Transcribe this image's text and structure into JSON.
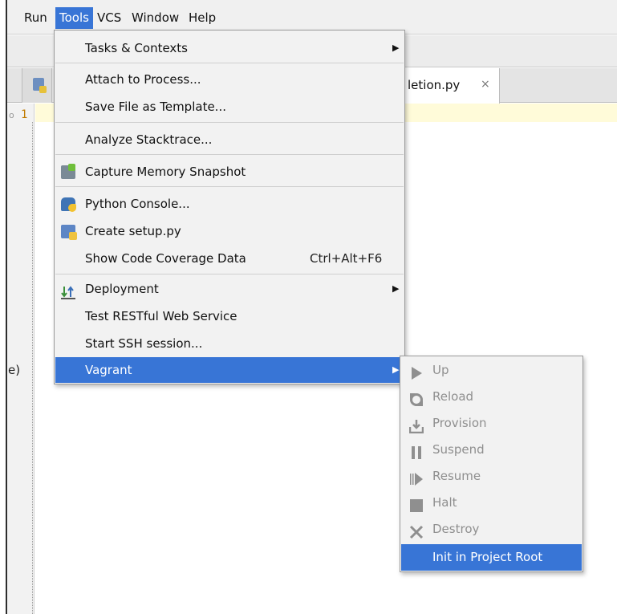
{
  "menubar": {
    "items": [
      {
        "label": "Run"
      },
      {
        "label": "Tools"
      },
      {
        "label": "VCS"
      },
      {
        "label": "Window"
      },
      {
        "label": "Help"
      }
    ]
  },
  "editor": {
    "active_tab": {
      "label": "letion.py",
      "close": "×"
    },
    "line_number": "1",
    "gutter_marker": "o",
    "side_text": "e)"
  },
  "tools_menu": {
    "items": [
      {
        "label": "Tasks & Contexts",
        "has_submenu": true
      },
      {
        "label": "Attach to Process..."
      },
      {
        "label": "Save File as Template..."
      },
      {
        "label": "Analyze Stacktrace..."
      },
      {
        "label": "Capture Memory Snapshot",
        "icon": "memory-snapshot-icon"
      },
      {
        "label": "Python Console...",
        "icon": "python-console-icon"
      },
      {
        "label": "Create setup.py",
        "icon": "setup-py-icon"
      },
      {
        "label": "Show Code Coverage Data",
        "shortcut": "Ctrl+Alt+F6"
      },
      {
        "label": "Deployment",
        "icon": "deployment-icon",
        "has_submenu": true
      },
      {
        "label": "Test RESTful Web Service"
      },
      {
        "label": "Start SSH session..."
      },
      {
        "label": "Vagrant",
        "has_submenu": true,
        "selected": true
      }
    ]
  },
  "vagrant_menu": {
    "items": [
      {
        "label": "Up",
        "icon": "play-icon",
        "enabled": false
      },
      {
        "label": "Reload",
        "icon": "reload-icon",
        "enabled": false
      },
      {
        "label": "Provision",
        "icon": "provision-icon",
        "enabled": false
      },
      {
        "label": "Suspend",
        "icon": "pause-icon",
        "enabled": false
      },
      {
        "label": "Resume",
        "icon": "resume-icon",
        "enabled": false
      },
      {
        "label": "Halt",
        "icon": "stop-icon",
        "enabled": false
      },
      {
        "label": "Destroy",
        "icon": "close-icon",
        "enabled": false
      },
      {
        "label": "Init in Project Root",
        "enabled": true,
        "selected": true
      }
    ]
  },
  "colors": {
    "selection": "#3875d6",
    "menu_bg": "#f2f2f2",
    "disabled_text": "#8f8f8f",
    "current_line": "#fffbd9"
  }
}
